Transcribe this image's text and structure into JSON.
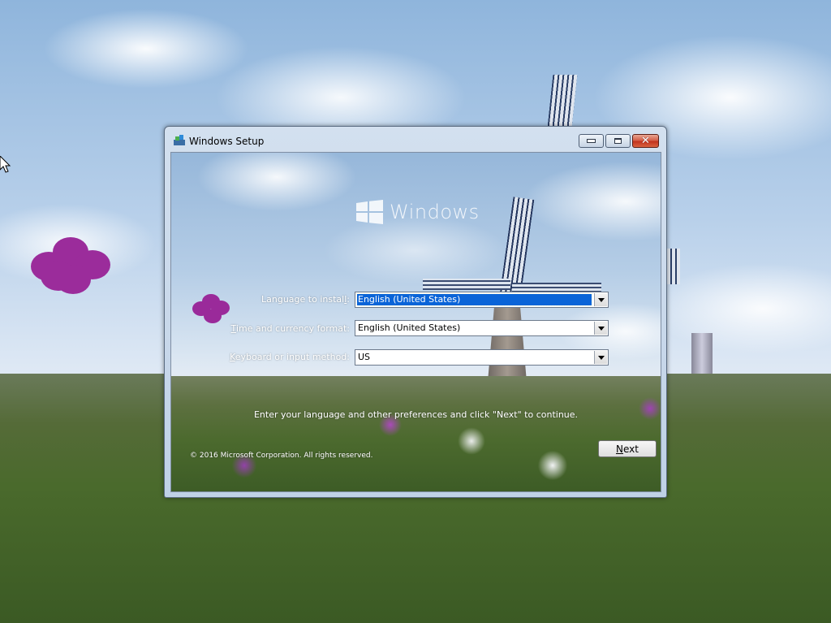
{
  "window": {
    "title": "Windows Setup",
    "minimize_icon": "minimize-icon",
    "maximize_icon": "maximize-icon",
    "close_icon": "close-icon"
  },
  "logo": {
    "text": "Windows"
  },
  "form": {
    "language": {
      "label_prefix": "Language to instal",
      "label_access": "l",
      "label_suffix": ":",
      "value": "English (United States)"
    },
    "time_currency": {
      "label_access": "T",
      "label_suffix": "ime and currency format:",
      "value": "English (United States)"
    },
    "keyboard": {
      "label_access": "K",
      "label_suffix": "eyboard or input method:",
      "value": "US"
    },
    "instruction": "Enter your language and other preferences and click \"Next\" to continue.",
    "copyright": "© 2016 Microsoft Corporation. All rights reserved.",
    "next": {
      "access": "N",
      "rest": "ext"
    }
  },
  "colors": {
    "selection": "#0a64d8",
    "close_button": "#c2331e"
  }
}
